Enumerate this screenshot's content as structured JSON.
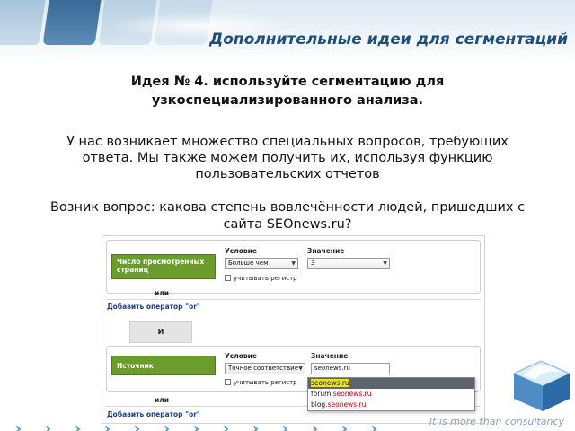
{
  "slide": {
    "title": "Дополнительные идеи для сегментаций",
    "subtitle_line1": "Идея № 4. используйте сегментацию для",
    "subtitle_line2": "узкоспециализированного анализа.",
    "paragraph1_line1": "У нас возникает множество специальных вопросов, требующих",
    "paragraph1_line2": "ответа. Мы также можем получить их, используя функцию",
    "paragraph1_line3": "пользовательских отчетов",
    "paragraph2_line1": "Возник вопрос: какова степень вовлечённости людей, пришедших с",
    "paragraph2_line2": "сайта SEOnews.ru?",
    "tagline": "It is more than consultancy"
  },
  "segment_editor": {
    "condition1": {
      "dimension": "Число просмотренных страниц",
      "condition_label": "Условие",
      "condition_value": "Больше чем",
      "value_label": "Значение",
      "value": "3",
      "case_label": "учитывать регистр"
    },
    "or_label": "или",
    "add_operator": "Добавить оператор \"or\"",
    "and_label": "И",
    "condition2": {
      "dimension": "Источник",
      "condition_label": "Условие",
      "condition_value": "Точное соответствие",
      "value_label": "Значение",
      "value": "seonews.ru",
      "case_label": "учитывать регистр"
    },
    "or_label2": "или",
    "add_operator2": "Добавить оператор \"or\"",
    "suggestions": [
      {
        "prefix": "",
        "match": "seonews.ru",
        "suffix": ""
      },
      {
        "prefix": "forum.",
        "match": "seonews.ru",
        "suffix": ""
      },
      {
        "prefix": "blog.",
        "match": "seonews.ru",
        "suffix": ""
      }
    ]
  },
  "colors": {
    "title": "#1f4e79",
    "segment_chip": "#6a9c2e",
    "link": "#1a3c8a",
    "match_text": "#c00000"
  }
}
